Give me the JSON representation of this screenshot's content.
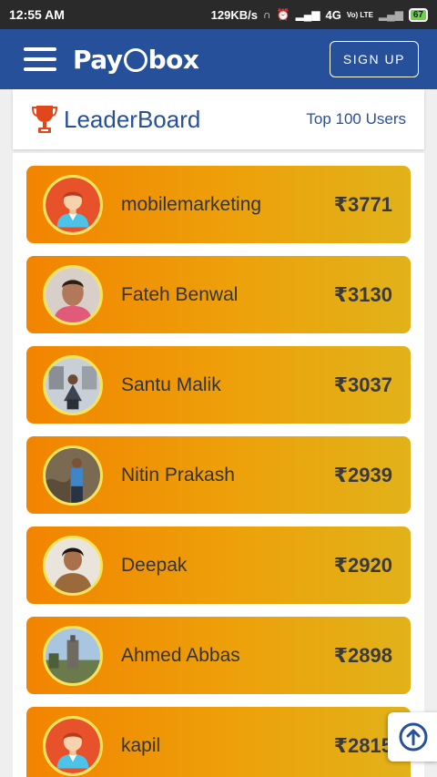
{
  "status_bar": {
    "time": "12:55 AM",
    "speed": "129KB/s",
    "network": "4G",
    "volte": "Vo) LTE",
    "battery": "67"
  },
  "navbar": {
    "logo_text_1": "Pay",
    "logo_text_2": "box",
    "signup_label": "SIGN UP",
    "bg_color": "#27509a"
  },
  "leaderboard": {
    "title": "LeaderBoard",
    "subtitle": "Top 100 Users",
    "entries": [
      {
        "name": "mobilemarketing",
        "amount": "₹3771",
        "avatar": "cartoon"
      },
      {
        "name": "Fateh Benwal",
        "amount": "₹3130",
        "avatar": "photo"
      },
      {
        "name": "Santu Malik",
        "amount": "₹3037",
        "avatar": "photo"
      },
      {
        "name": "Nitin Prakash",
        "amount": "₹2939",
        "avatar": "photo"
      },
      {
        "name": "Deepak",
        "amount": "₹2920",
        "avatar": "photo"
      },
      {
        "name": "Ahmed Abbas",
        "amount": "₹2898",
        "avatar": "photo"
      },
      {
        "name": "kapil",
        "amount": "₹2815",
        "avatar": "cartoon"
      }
    ]
  },
  "icons": {
    "menu": "hamburger-menu-icon",
    "trophy": "trophy-icon",
    "scroll_top": "arrow-up-circle-icon"
  }
}
